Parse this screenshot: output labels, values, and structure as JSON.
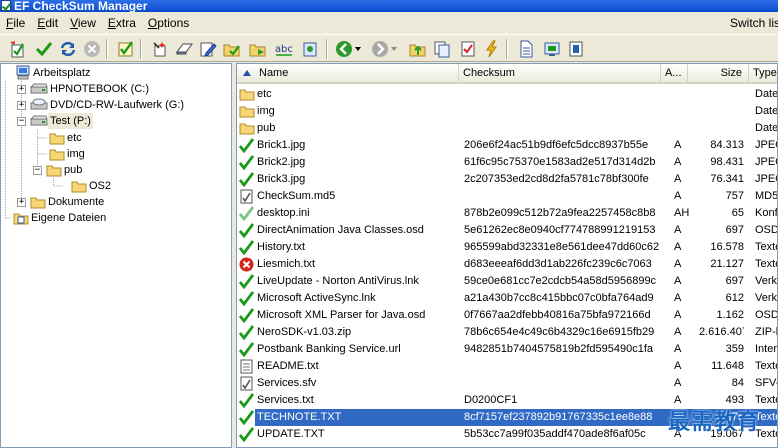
{
  "window": {
    "title": "EF CheckSum Manager"
  },
  "menu": {
    "items": [
      {
        "label": "File",
        "acc": "F",
        "rest": "ile"
      },
      {
        "label": "Edit",
        "acc": "E",
        "rest": "dit"
      },
      {
        "label": "View",
        "acc": "V",
        "rest": "iew"
      },
      {
        "label": "Extra",
        "acc": "E",
        "rest": "xtra"
      },
      {
        "label": "Options",
        "acc": "O",
        "rest": "ptions"
      }
    ],
    "switch_link": "Switch lis"
  },
  "toolbar": {
    "buttons": [
      "new-checksum-icon",
      "verify-icon",
      "refresh-icon",
      "stop-icon",
      "check-all-icon",
      "wand-icon",
      "eraser-icon",
      "edit-icon",
      "folder-green-icon",
      "folder-yellow-icon",
      "abc-icon",
      "settings-icon",
      "back-icon",
      "forward-icon",
      "up-folder-icon",
      "copy-icon",
      "checklist-icon",
      "lightning-icon",
      "document-icon",
      "export-icon",
      "info-icon"
    ]
  },
  "tree": {
    "nodes": [
      {
        "label": "Arbeitsplatz",
        "icon": "computer-icon"
      },
      {
        "label": "HPNOTEBOOK (C:)",
        "icon": "drive-icon"
      },
      {
        "label": "DVD/CD-RW-Laufwerk (G:)",
        "icon": "cdrom-icon"
      },
      {
        "label": "Test (P:)",
        "icon": "drive-icon"
      },
      {
        "label": "etc",
        "icon": "folder-icon"
      },
      {
        "label": "img",
        "icon": "folder-icon"
      },
      {
        "label": "pub",
        "icon": "folder-icon"
      },
      {
        "label": "OS2",
        "icon": "folder-icon"
      },
      {
        "label": "Dokumente",
        "icon": "folder-icon"
      },
      {
        "label": "Eigene Dateien",
        "icon": "documents-icon"
      }
    ]
  },
  "list": {
    "columns": {
      "name": "Name",
      "checksum": "Checksum",
      "attr": "A...",
      "size": "Size",
      "type": "Type"
    },
    "rows": [
      {
        "icon": "folder",
        "name": "etc",
        "checksum": "",
        "attr": "",
        "size": "",
        "type": "Date"
      },
      {
        "icon": "folder",
        "name": "img",
        "checksum": "",
        "attr": "",
        "size": "",
        "type": "Date"
      },
      {
        "icon": "folder",
        "name": "pub",
        "checksum": "",
        "attr": "",
        "size": "",
        "type": "Date"
      },
      {
        "icon": "check",
        "name": "Brick1.jpg",
        "checksum": "206e6f24ac51b9df6efc5dcc8937b55e",
        "attr": "A",
        "size": "84.313",
        "type": "JPEG"
      },
      {
        "icon": "check",
        "name": "Brick2.jpg",
        "checksum": "61f6c95c75370e1583ad2e517d314d2b",
        "attr": "A",
        "size": "98.431",
        "type": "JPEG"
      },
      {
        "icon": "check",
        "name": "Brick3.jpg",
        "checksum": "2c207353ed2cd8d2fa5781c78bf300fe",
        "attr": "A",
        "size": "76.341",
        "type": "JPEG"
      },
      {
        "icon": "md5",
        "name": "CheckSum.md5",
        "checksum": "",
        "attr": "A",
        "size": "757",
        "type": "MD5-"
      },
      {
        "icon": "check-light",
        "name": "desktop.ini",
        "checksum": "878b2e099c512b72a9fea2257458c8b8",
        "attr": "AH",
        "size": "65",
        "type": "Konfi"
      },
      {
        "icon": "check",
        "name": "DirectAnimation Java Classes.osd",
        "checksum": "5e61262ec8e0940cf774788991219153",
        "attr": "A",
        "size": "697",
        "type": "OSD-"
      },
      {
        "icon": "check",
        "name": "History.txt",
        "checksum": "965599abd32331e8e561dee47dd60c62",
        "attr": "A",
        "size": "16.578",
        "type": "Texte"
      },
      {
        "icon": "error",
        "name": "Liesmich.txt",
        "checksum": "d683eeeaf6dd3d1ab226fc239c6c7063",
        "attr": "A",
        "size": "21.127",
        "type": "Texte"
      },
      {
        "icon": "check",
        "name": "LiveUpdate - Norton AntiVirus.lnk",
        "checksum": "59ce0e681cc7e2cdcb54a58d5956899c",
        "attr": "A",
        "size": "697",
        "type": "Verkn"
      },
      {
        "icon": "check",
        "name": "Microsoft ActiveSync.lnk",
        "checksum": "a21a430b7cc8c415bbc07c0bfa764ad9",
        "attr": "A",
        "size": "612",
        "type": "Verkn"
      },
      {
        "icon": "check",
        "name": "Microsoft XML Parser for Java.osd",
        "checksum": "0f7667aa2dfebb40816a75bfa972166d",
        "attr": "A",
        "size": "1.162",
        "type": "OSD-"
      },
      {
        "icon": "check",
        "name": "NeroSDK-v1.03.zip",
        "checksum": "78b6c654e4c49c6b4329c16e6915fb29",
        "attr": "A",
        "size": "2.616.407",
        "type": "ZIP-k"
      },
      {
        "icon": "check",
        "name": "Postbank Banking Service.url",
        "checksum": "9482851b7404575819b2fd595490c1fa",
        "attr": "A",
        "size": "359",
        "type": "Inter"
      },
      {
        "icon": "txt",
        "name": "README.txt",
        "checksum": "",
        "attr": "A",
        "size": "11.648",
        "type": "Texte"
      },
      {
        "icon": "sfv",
        "name": "Services.sfv",
        "checksum": "",
        "attr": "A",
        "size": "84",
        "type": "SFV-I"
      },
      {
        "icon": "check",
        "name": "Services.txt",
        "checksum": "D0200CF1",
        "attr": "A",
        "size": "493",
        "type": "Texte"
      },
      {
        "icon": "check",
        "name": "TECHNOTE.TXT",
        "checksum": "8cf7157ef237892b91767335c1ee8e88",
        "attr": "A",
        "size": "2.175",
        "type": "Texte",
        "selected": true
      },
      {
        "icon": "check",
        "name": "UPDATE.TXT",
        "checksum": "5b53cc7a99f035addf470ade8f6af05c",
        "attr": "A",
        "size": "19.067",
        "type": "Texte"
      }
    ]
  },
  "watermark": "最需教育"
}
